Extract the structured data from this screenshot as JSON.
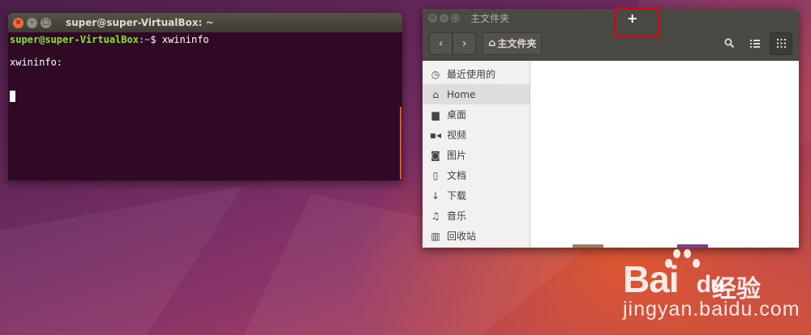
{
  "terminal": {
    "title": "super@super-VirtualBox: ~",
    "prompt_user": "super@super-VirtualBox",
    "prompt_path": ":~",
    "prompt_symbol": "$ ",
    "command": "xwininfo",
    "output": "xwininfo:"
  },
  "files": {
    "title": "主文件夹",
    "path_label": "主文件夹",
    "sidebar": [
      {
        "icon": "clock-icon",
        "label": "最近使用的"
      },
      {
        "icon": "home-icon",
        "label": "Home"
      },
      {
        "icon": "folder-icon",
        "label": "桌面"
      },
      {
        "icon": "video-icon",
        "label": "视频"
      },
      {
        "icon": "camera-icon",
        "label": "图片"
      },
      {
        "icon": "document-icon",
        "label": "文档"
      },
      {
        "icon": "download-icon",
        "label": "下载"
      },
      {
        "icon": "music-icon",
        "label": "音乐"
      },
      {
        "icon": "trash-icon",
        "label": "回收站"
      }
    ]
  },
  "watermark": {
    "brand": "Bai",
    "brand_suffix": "du",
    "product": "经验",
    "url": "jingyan.baidu.com"
  },
  "colors": {
    "terminal_bg": "#300a24",
    "prompt_user": "#8ae234",
    "prompt_path": "#729fcf",
    "highlight": "#e3000f",
    "accent": "#e95420"
  }
}
